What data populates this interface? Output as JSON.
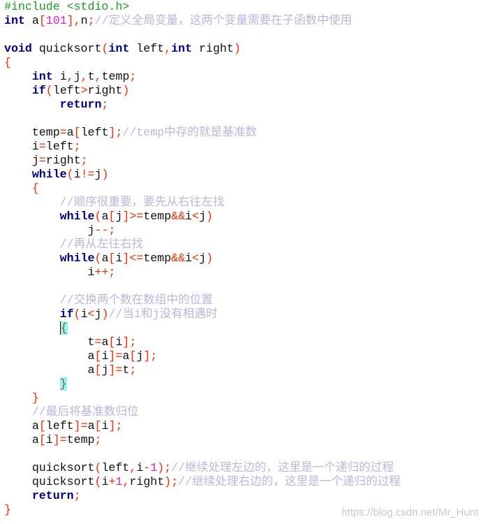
{
  "editor": {
    "language": "c",
    "lines": [
      "#include <stdio.h>",
      "int a[101],n;//定义全局变量，这两个变量需要在子函数中使用",
      "",
      "void quicksort(int left,int right)",
      "{",
      "    int i,j,t,temp;",
      "    if(left>right)",
      "        return;",
      "",
      "    temp=a[left];//temp中存的就是基准数",
      "    i=left;",
      "    j=right;",
      "    while(i!=j)",
      "    {",
      "        //顺序很重要，要先从右往左找",
      "        while(a[j]>=temp&&i<j)",
      "            j--;",
      "        //再从左往右找",
      "        while(a[i]<=temp&&i<j)",
      "            i++;",
      "",
      "        //交换两个数在数组中的位置",
      "        if(i<j)//当i和j没有相遇时",
      "        {",
      "            t=a[i];",
      "            a[i]=a[j];",
      "            a[j]=t;",
      "        }",
      "    }",
      "    //最后将基准数归位",
      "    a[left]=a[i];",
      "    a[i]=temp;",
      "",
      "    quicksort(left,i-1);//继续处理左边的，这里是一个递归的过程",
      "    quicksort(i+1,right);//继续处理右边的，这里是一个递归的过程",
      "    return;",
      "}"
    ],
    "matched_brace_lines": [
      24,
      28
    ],
    "cursor_line": 24,
    "colors": {
      "keyword": "#00008b",
      "preprocessor": "#1f9a1f",
      "operator": "#ff2a00",
      "number": "#e020d0",
      "comment": "#b8b8dc",
      "brace_match": "#80ffff"
    }
  },
  "watermark": "https://blog.csdn.net/Mr_Hunt"
}
